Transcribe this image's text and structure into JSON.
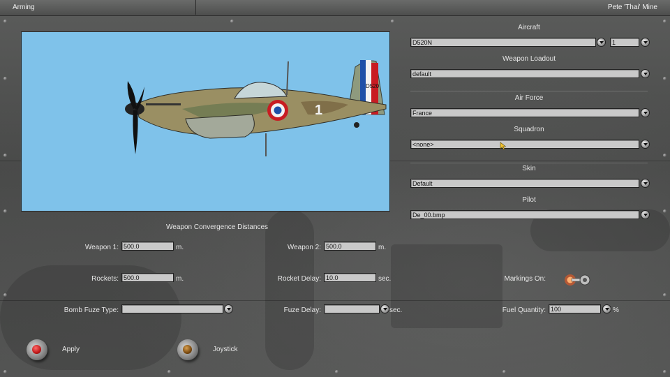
{
  "window": {
    "title_left": "Arming",
    "title_right": "Pete 'Thai' Mine"
  },
  "aircraft_preview": {
    "tail_code": "D520",
    "fuselage_number": "1"
  },
  "right_panel": {
    "aircraft": {
      "label": "Aircraft",
      "value": "D520N",
      "count": "1"
    },
    "weapon_loadout": {
      "label": "Weapon Loadout",
      "value": "default"
    },
    "air_force": {
      "label": "Air Force",
      "value": "France"
    },
    "squadron": {
      "label": "Squadron",
      "value": "<none>"
    },
    "skin": {
      "label": "Skin",
      "value": "Default"
    },
    "pilot": {
      "label": "Pilot",
      "value": "De_00.bmp"
    }
  },
  "convergence": {
    "heading": "Weapon Convergence Distances",
    "weapon1": {
      "label": "Weapon 1:",
      "value": "500.0",
      "unit": "m."
    },
    "weapon2": {
      "label": "Weapon 2:",
      "value": "500.0",
      "unit": "m."
    },
    "rockets": {
      "label": "Rockets:",
      "value": "500.0",
      "unit": "m."
    },
    "rocket_delay": {
      "label": "Rocket Delay:",
      "value": "10.0",
      "unit": "sec."
    },
    "bomb_fuze_type": {
      "label": "Bomb Fuze Type:",
      "value": ""
    },
    "fuze_delay": {
      "label": "Fuze Delay:",
      "value": "",
      "unit": "sec."
    },
    "markings": {
      "label": "Markings On:",
      "state": "on"
    },
    "fuel": {
      "label": "Fuel Quantity:",
      "value": "100",
      "unit": "%"
    }
  },
  "buttons": {
    "apply": "Apply",
    "joystick": "Joystick"
  },
  "colors": {
    "sky": "#7fc2ea",
    "field": "#c9c9c9",
    "apply_knob": "#c01818",
    "joystick_knob": "#7a4a10",
    "toggle_light": "#ff5a1a"
  }
}
